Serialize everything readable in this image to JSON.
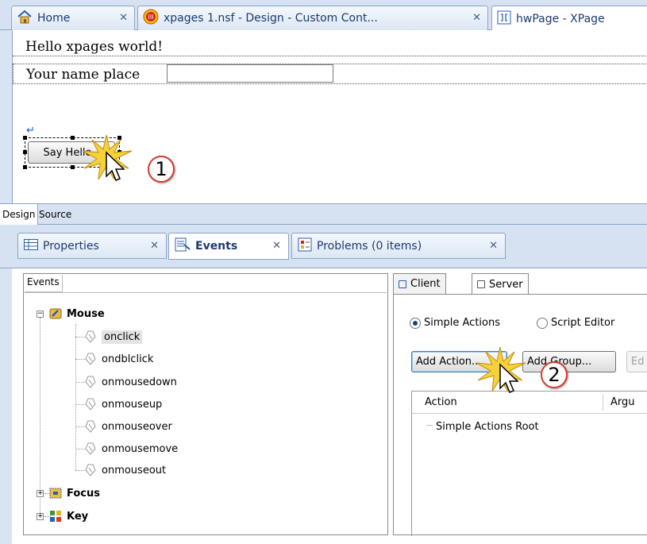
{
  "editor_tabs": [
    {
      "label": "Home",
      "icon": "house-icon"
    },
    {
      "label": "xpages 1.nsf - Design - Custom Cont...",
      "icon": "database-icon"
    },
    {
      "label": "hwPage - XPage",
      "icon": "xpage-icon"
    }
  ],
  "canvas": {
    "heading": "Hello xpages world!",
    "name_label": "Your name place",
    "name_value": "",
    "button_label": "Say Hello"
  },
  "design_tabs": [
    "Design",
    "Source"
  ],
  "view_tabs": [
    {
      "label": "Properties",
      "icon": "properties-grid-icon"
    },
    {
      "label": "Events",
      "icon": "events-icon"
    },
    {
      "label": "Problems (0 items)",
      "icon": "problems-icon"
    }
  ],
  "events_tree": {
    "header": "Events",
    "groups": [
      {
        "label": "Mouse",
        "icon": "mouse-icon",
        "expanded": true,
        "items": [
          "onclick",
          "ondblclick",
          "onmousedown",
          "onmouseup",
          "onmouseover",
          "onmousemove",
          "onmouseout"
        ],
        "selected": "onclick"
      },
      {
        "label": "Focus",
        "icon": "focus-icon",
        "expanded": false
      },
      {
        "label": "Key",
        "icon": "key-icon",
        "expanded": false
      }
    ]
  },
  "script_tabs": [
    "Client",
    "Server"
  ],
  "server": {
    "mode_options": [
      "Simple Actions",
      "Script Editor"
    ],
    "selected_mode": "Simple Actions",
    "buttons": [
      "Add Action...",
      "Add Group...",
      "Ed"
    ],
    "columns": [
      "Action",
      "Argu"
    ],
    "rows": [
      "Simple Actions Root"
    ]
  },
  "callouts": [
    "1",
    "2"
  ],
  "colors": {
    "accent_blue": "#1d3a6e",
    "callout_red": "#d43c2e",
    "chrome": "#d6e2f1"
  }
}
